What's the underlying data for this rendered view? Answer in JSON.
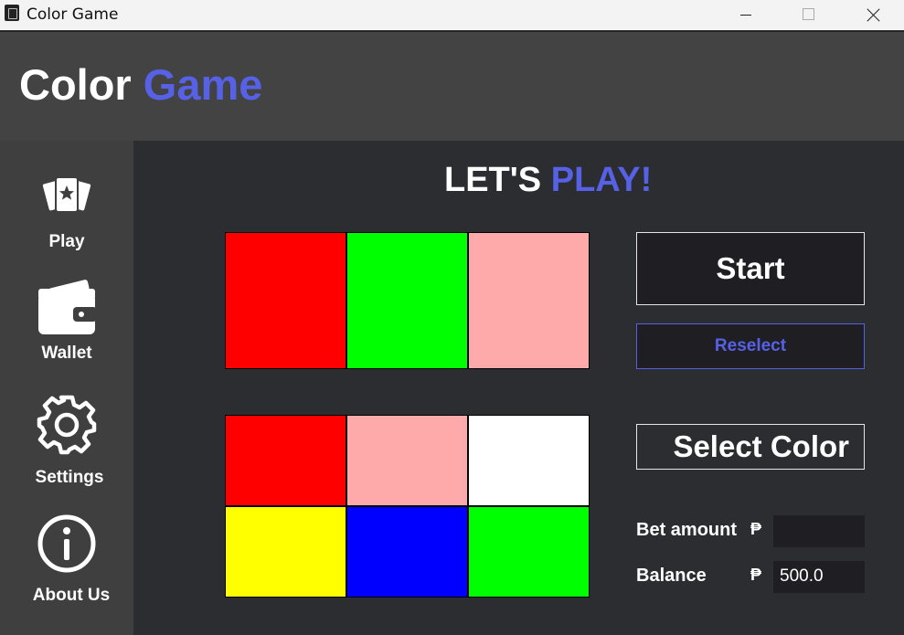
{
  "window": {
    "title": "Color Game",
    "icon": "app-icon"
  },
  "header": {
    "title_part1": "Color",
    "title_part2": "Game",
    "accent_color": "#5661e6"
  },
  "sidebar": {
    "items": [
      {
        "label": "Play",
        "icon": "cards-icon"
      },
      {
        "label": "Wallet",
        "icon": "wallet-icon"
      },
      {
        "label": "Settings",
        "icon": "gear-icon"
      },
      {
        "label": "About Us",
        "icon": "info-icon"
      }
    ]
  },
  "main": {
    "heading_part1": "LET'S",
    "heading_part2": "PLAY!",
    "result_colors": [
      "#ff0000",
      "#00ff00",
      "#ffaaaa"
    ],
    "palette_colors": [
      "#ff0000",
      "#ffaaaa",
      "#ffffff",
      "#ffff00",
      "#0000ff",
      "#00ff00"
    ],
    "start_label": "Start",
    "reselect_label": "Reselect",
    "select_color_label": "Select Color",
    "bet_label": "Bet amount",
    "balance_label": "Balance",
    "currency_symbol": "₱",
    "bet_value": "",
    "balance_value": "500.0"
  }
}
